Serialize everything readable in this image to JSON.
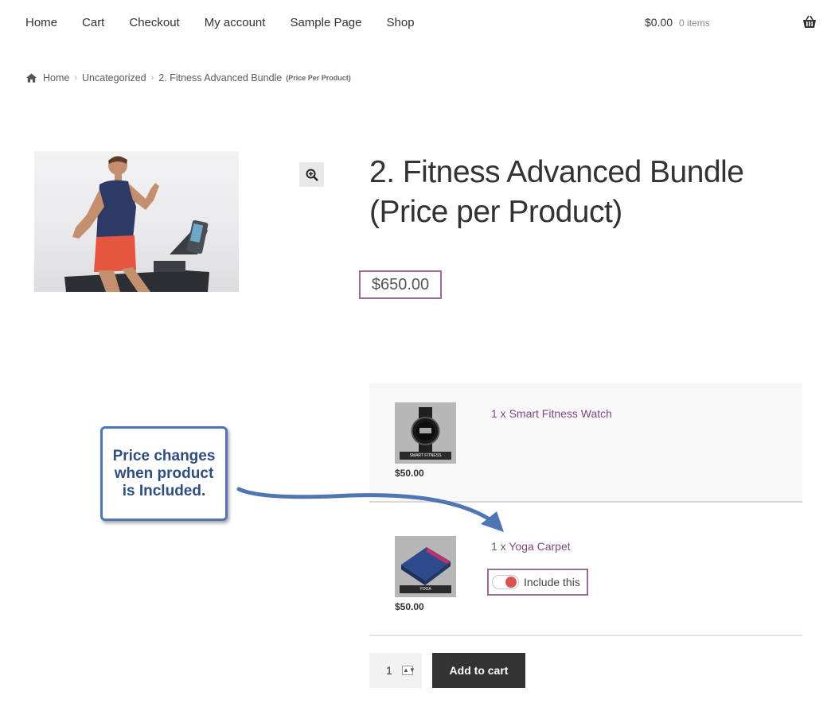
{
  "nav": {
    "items": [
      "Home",
      "Cart",
      "Checkout",
      "My account",
      "Sample Page",
      "Shop"
    ]
  },
  "cart": {
    "amount": "$0.00",
    "count": "0 items"
  },
  "breadcrumb": {
    "home": "Home",
    "category": "Uncategorized",
    "current": "2. Fitness Advanced Bundle",
    "current_suffix": "(Price Per Product)"
  },
  "product": {
    "title": "2. Fitness Advanced Bundle (Price per Product)",
    "price": "$650.00"
  },
  "bundle_items": [
    {
      "name": "1 x Smart Fitness Watch",
      "price": "$50.00",
      "thumb_label": "SMART FITNESS"
    },
    {
      "name": "1 x Yoga Carpet",
      "price": "$50.00",
      "thumb_label": "YOGA",
      "include_label": "Include this",
      "included": true
    }
  ],
  "quantity": {
    "value": "1"
  },
  "add_to_cart_label": "Add to cart",
  "annotation": {
    "text": "Price changes when product is Included."
  },
  "colors": {
    "accent_purple": "#9b6a9a",
    "link_purple": "#7e4a7e",
    "toggle_on": "#d9534f",
    "callout_border": "#4f75b5",
    "button_dark": "#333333"
  }
}
